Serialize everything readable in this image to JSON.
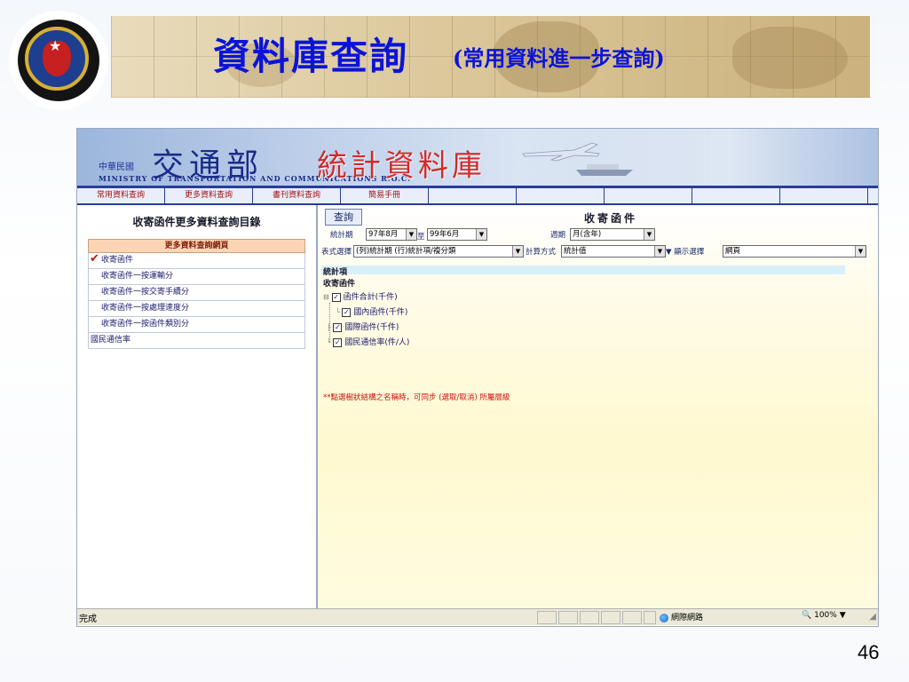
{
  "slide": {
    "title": "資料庫查詢",
    "subtitle": "(常用資料進一步查詢)",
    "page_number": "46"
  },
  "site": {
    "country_small": "中華民國",
    "ministry": "交通部",
    "ministry_en": "MINISTRY OF TRANSPORTATION AND COMMUNICATIONS R.O.C.",
    "db_title": "統計資料庫"
  },
  "nav": [
    "常用資料查詢",
    "更多資料查詢",
    "書刊資料查詢",
    "簡易手冊",
    "",
    "",
    "",
    "",
    ""
  ],
  "left": {
    "title": "收寄函件更多資料查詢目錄",
    "menu_header": "更多資料查詢網頁",
    "items": [
      "收寄函件",
      "收寄函件一按運輸分",
      "收寄函件一按交寄手續分",
      "收寄函件一按處理速度分",
      "收寄函件一按函件類別分",
      "國民通信率"
    ],
    "checked_index": 0
  },
  "right": {
    "query_button": "查詢",
    "title": "收寄函件",
    "period_label": "統計期",
    "period_from": "97年8月",
    "period_sep": "至",
    "period_to": "99年6月",
    "frequency_label": "週期",
    "frequency": "月(含年)",
    "table_label": "表式選擇",
    "table_value": "(列)統計期  (行)統計項/複分類",
    "calc_label": "計算方式",
    "calc_value": "統計值",
    "display_label": "顯示選擇",
    "display_value": "網頁",
    "stat_header": "統計項",
    "stat_group": "收寄函件",
    "tree": [
      "函件合計(千件)",
      "國內函件(千件)",
      "國際函件(千件)",
      "國民通信率(件/人)"
    ],
    "note": "**點選樹狀結構之名稱時，可同步 (選取/取消) 所屬層級"
  },
  "status": {
    "text": "完成",
    "zone": "網際網路",
    "zoom": "100%"
  },
  "colors": {
    "title_blue": "#0a14d8",
    "nav_text": "#a01414",
    "note_red": "#d01010"
  }
}
